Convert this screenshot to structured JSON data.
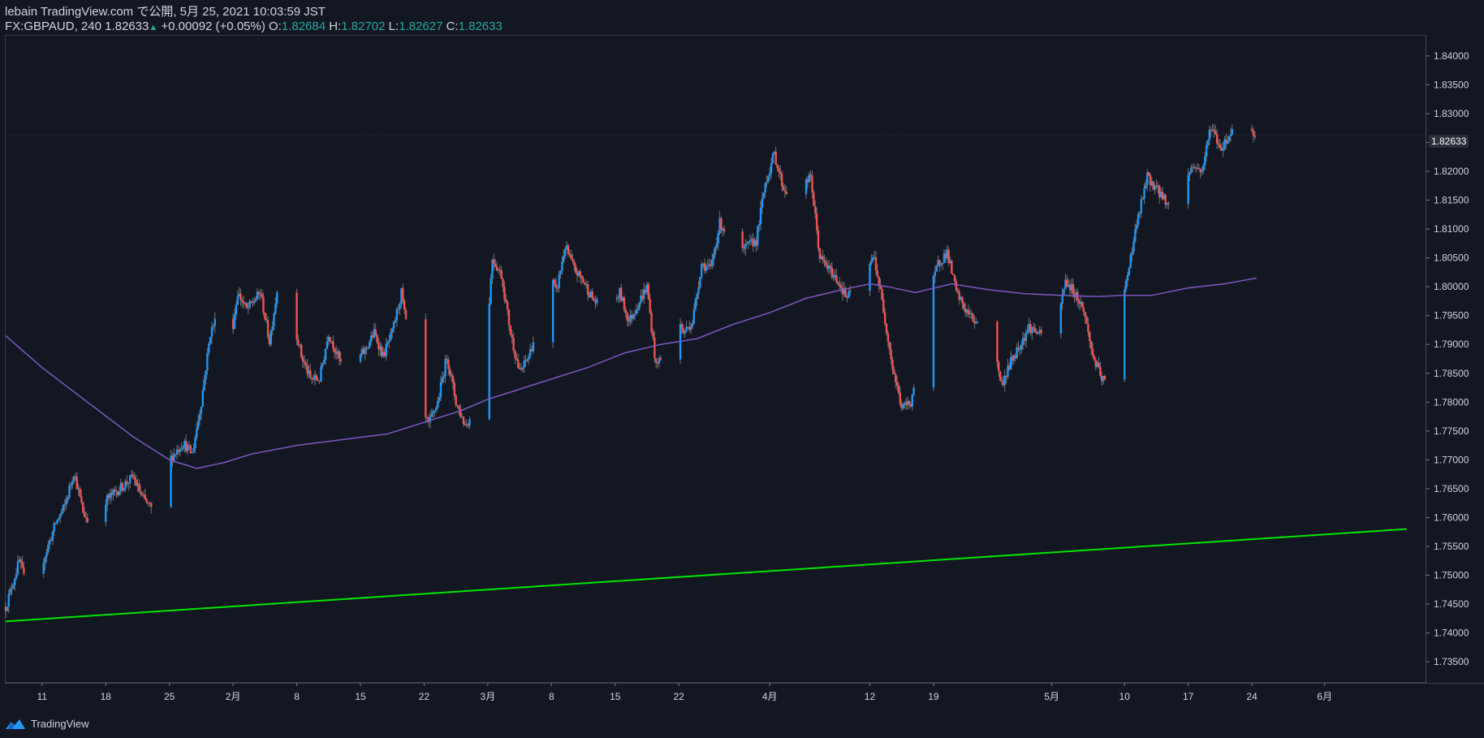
{
  "header": {
    "line1": "lebain TradingView.com で公開, 5月 25, 2021 10:03:59 JST",
    "symbol": "FX:GBPAUD, 240",
    "last": "1.82633",
    "change_icon": "triangle-up-icon",
    "change": "+0.00092 (+0.05%)",
    "o_label": "O:",
    "o_value": "1.82684",
    "h_label": "H:",
    "h_value": "1.82702",
    "l_label": "L:",
    "l_value": "1.82627",
    "c_label": "C:",
    "c_value": "1.82633"
  },
  "footer": {
    "logo_label": "TradingView",
    "logo_icon": "tradingview-logo-icon"
  },
  "colors": {
    "background": "#131722",
    "up": "#2196f3",
    "down": "#ef5350",
    "ma": "#7e57c2",
    "trendline": "#00e600",
    "value_text": "#26a69a"
  },
  "chart_data": {
    "type": "candlestick",
    "timeframe": "240",
    "symbol": "FX:GBPAUD",
    "ylim": [
      1.7315,
      1.8435
    ],
    "y_ticks": [
      "1.84000",
      "1.83500",
      "1.83000",
      "1.82500",
      "1.82000",
      "1.81500",
      "1.81000",
      "1.80500",
      "1.80000",
      "1.79500",
      "1.79000",
      "1.78500",
      "1.78000",
      "1.77500",
      "1.77000",
      "1.76500",
      "1.76000",
      "1.75500",
      "1.75000",
      "1.74500",
      "1.74000",
      "1.73500"
    ],
    "x_ticks": [
      {
        "label": "11",
        "index": 0
      },
      {
        "label": "18",
        "index": 1
      },
      {
        "label": "25",
        "index": 2
      },
      {
        "label": "2月",
        "index": 3
      },
      {
        "label": "8",
        "index": 4
      },
      {
        "label": "15",
        "index": 5
      },
      {
        "label": "22",
        "index": 6
      },
      {
        "label": "3月",
        "index": 7
      },
      {
        "label": "8",
        "index": 8
      },
      {
        "label": "15",
        "index": 9
      },
      {
        "label": "22",
        "index": 10
      },
      {
        "label": "4月",
        "index": 11
      },
      {
        "label": "12",
        "index": 12
      },
      {
        "label": "19",
        "index": 13
      },
      {
        "label": "5月",
        "index": 14
      },
      {
        "label": "10",
        "index": 15
      },
      {
        "label": "17",
        "index": 16
      },
      {
        "label": "24",
        "index": 17
      },
      {
        "label": "6月",
        "index": 18
      }
    ],
    "x_tick_days": [
      0,
      7,
      14,
      21,
      28,
      35,
      42,
      49,
      56,
      63,
      70,
      80,
      91,
      98,
      111,
      119,
      126,
      133,
      141
    ],
    "x_range_days": [
      -4.0,
      152.0
    ],
    "close_path": [
      [
        -4.0,
        1.7445
      ],
      [
        -2.5,
        1.7525
      ],
      [
        -1.5,
        1.7465
      ],
      [
        0.0,
        1.752
      ],
      [
        1.5,
        1.759
      ],
      [
        2.5,
        1.762
      ],
      [
        3.5,
        1.768
      ],
      [
        4.5,
        1.761
      ],
      [
        5.5,
        1.758
      ],
      [
        7.0,
        1.763
      ],
      [
        8.5,
        1.765
      ],
      [
        10.0,
        1.767
      ],
      [
        11.0,
        1.7635
      ],
      [
        12.5,
        1.7605
      ],
      [
        14.0,
        1.77
      ],
      [
        15.5,
        1.773
      ],
      [
        16.5,
        1.771
      ],
      [
        17.5,
        1.78
      ],
      [
        18.5,
        1.792
      ],
      [
        19.5,
        1.796
      ],
      [
        20.5,
        1.788
      ],
      [
        21.5,
        1.799
      ],
      [
        22.5,
        1.796
      ],
      [
        24.0,
        1.799
      ],
      [
        25.0,
        1.7905
      ],
      [
        26.0,
        1.801
      ],
      [
        27.0,
        1.799
      ],
      [
        28.5,
        1.788
      ],
      [
        29.5,
        1.784
      ],
      [
        30.5,
        1.784
      ],
      [
        31.5,
        1.792
      ],
      [
        32.5,
        1.788
      ],
      [
        33.5,
        1.784
      ],
      [
        34.5,
        1.787
      ],
      [
        35.5,
        1.789
      ],
      [
        36.5,
        1.792
      ],
      [
        37.5,
        1.788
      ],
      [
        38.5,
        1.792
      ],
      [
        39.5,
        1.799
      ],
      [
        40.5,
        1.788
      ],
      [
        41.5,
        1.779
      ],
      [
        42.5,
        1.776
      ],
      [
        43.5,
        1.78
      ],
      [
        44.5,
        1.788
      ],
      [
        45.5,
        1.78
      ],
      [
        46.5,
        1.776
      ],
      [
        47.5,
        1.778
      ],
      [
        48.5,
        1.783
      ],
      [
        49.5,
        1.805
      ],
      [
        50.5,
        1.802
      ],
      [
        51.5,
        1.792
      ],
      [
        52.5,
        1.785
      ],
      [
        53.5,
        1.788
      ],
      [
        54.5,
        1.793
      ],
      [
        55.5,
        1.804
      ],
      [
        56.5,
        1.799
      ],
      [
        57.5,
        1.807
      ],
      [
        58.5,
        1.803
      ],
      [
        59.5,
        1.801
      ],
      [
        60.5,
        1.798
      ],
      [
        61.5,
        1.796
      ],
      [
        62.5,
        1.796
      ],
      [
        63.5,
        1.799
      ],
      [
        64.5,
        1.794
      ],
      [
        65.5,
        1.797
      ],
      [
        66.5,
        1.8
      ],
      [
        67.5,
        1.786
      ],
      [
        68.5,
        1.79
      ],
      [
        69.5,
        1.796
      ],
      [
        70.5,
        1.792
      ],
      [
        71.5,
        1.794
      ],
      [
        72.5,
        1.804
      ],
      [
        73.5,
        1.803
      ],
      [
        74.5,
        1.811
      ],
      [
        75.5,
        1.809
      ],
      [
        76.5,
        1.805
      ],
      [
        77.5,
        1.807
      ],
      [
        78.5,
        1.808
      ],
      [
        79.5,
        1.818
      ],
      [
        80.5,
        1.823
      ],
      [
        81.5,
        1.817
      ],
      [
        82.5,
        1.816
      ],
      [
        83.5,
        1.817
      ],
      [
        84.5,
        1.819
      ],
      [
        85.5,
        1.805
      ],
      [
        86.5,
        1.803
      ],
      [
        87.5,
        1.801
      ],
      [
        88.5,
        1.798
      ],
      [
        89.5,
        1.8
      ],
      [
        90.5,
        1.803
      ],
      [
        91.5,
        1.805
      ],
      [
        92.5,
        1.796
      ],
      [
        93.5,
        1.786
      ],
      [
        94.5,
        1.779
      ],
      [
        95.5,
        1.78
      ],
      [
        96.5,
        1.788
      ],
      [
        97.5,
        1.798
      ],
      [
        98.5,
        1.804
      ],
      [
        99.5,
        1.806
      ],
      [
        100.5,
        1.799
      ],
      [
        101.5,
        1.796
      ],
      [
        102.5,
        1.794
      ],
      [
        103.5,
        1.795
      ],
      [
        104.5,
        1.79
      ],
      [
        105.5,
        1.783
      ],
      [
        106.5,
        1.787
      ],
      [
        107.5,
        1.79
      ],
      [
        108.5,
        1.793
      ],
      [
        109.5,
        1.792
      ],
      [
        110.5,
        1.79
      ],
      [
        111.5,
        1.793
      ],
      [
        112.5,
        1.801
      ],
      [
        113.5,
        1.799
      ],
      [
        114.5,
        1.796
      ],
      [
        115.5,
        1.788
      ],
      [
        116.5,
        1.784
      ],
      [
        117.5,
        1.783
      ],
      [
        118.5,
        1.794
      ],
      [
        119.5,
        1.804
      ],
      [
        120.5,
        1.812
      ],
      [
        121.5,
        1.819
      ],
      [
        122.5,
        1.817
      ],
      [
        123.5,
        1.815
      ],
      [
        124.5,
        1.812
      ],
      [
        125.5,
        1.818
      ],
      [
        126.5,
        1.821
      ],
      [
        127.5,
        1.82
      ],
      [
        128.5,
        1.828
      ],
      [
        129.5,
        1.824
      ],
      [
        130.5,
        1.826
      ],
      [
        131.5,
        1.831
      ],
      [
        132.5,
        1.827
      ],
      [
        133.5,
        1.8263
      ]
    ],
    "ma_path": [
      [
        -4.0,
        1.7915
      ],
      [
        0.0,
        1.786
      ],
      [
        5.0,
        1.78
      ],
      [
        10.0,
        1.774
      ],
      [
        14.0,
        1.77
      ],
      [
        17.0,
        1.7685
      ],
      [
        20.0,
        1.7695
      ],
      [
        23.0,
        1.771
      ],
      [
        28.0,
        1.7725
      ],
      [
        33.0,
        1.7735
      ],
      [
        38.0,
        1.7745
      ],
      [
        42.0,
        1.7765
      ],
      [
        46.0,
        1.7785
      ],
      [
        49.0,
        1.7805
      ],
      [
        52.0,
        1.782
      ],
      [
        56.0,
        1.784
      ],
      [
        60.0,
        1.786
      ],
      [
        64.0,
        1.7885
      ],
      [
        68.0,
        1.79
      ],
      [
        72.0,
        1.791
      ],
      [
        76.0,
        1.7935
      ],
      [
        80.0,
        1.7955
      ],
      [
        84.0,
        1.798
      ],
      [
        88.0,
        1.7995
      ],
      [
        91.0,
        1.8005
      ],
      [
        93.0,
        1.8
      ],
      [
        96.0,
        1.799
      ],
      [
        100.0,
        1.8005
      ],
      [
        104.0,
        1.7995
      ],
      [
        108.0,
        1.7988
      ],
      [
        112.0,
        1.7985
      ],
      [
        116.0,
        1.7983
      ],
      [
        119.0,
        1.7985
      ],
      [
        122.0,
        1.7985
      ],
      [
        126.0,
        1.7998
      ],
      [
        130.0,
        1.8005
      ],
      [
        133.5,
        1.8015
      ]
    ],
    "trendline": {
      "x1_day": -4.0,
      "y1": 1.742,
      "x2_day": 150.0,
      "y2": 1.758
    },
    "last_price_label": "1.82633",
    "last_price_value": 1.82633,
    "grid": false
  }
}
